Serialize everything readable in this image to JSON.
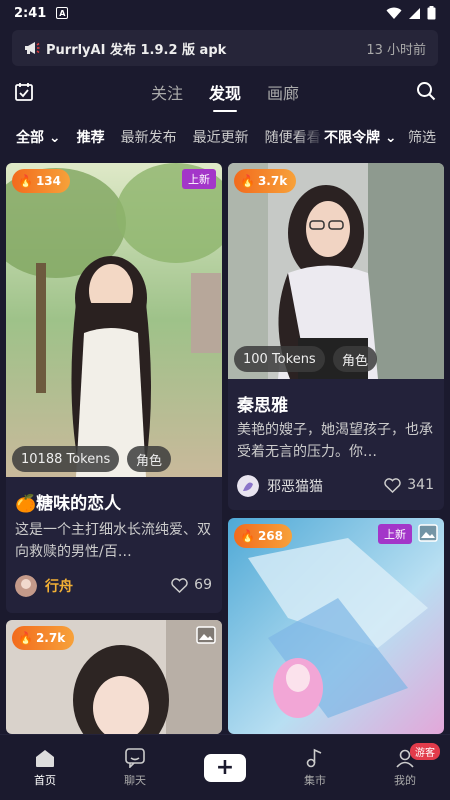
{
  "status": {
    "time": "2:41",
    "notif_icon": "A"
  },
  "notice": {
    "icon": "megaphone-icon",
    "title": "PurrlyAI 发布 1.9.2 版 apk",
    "time": "13 小时前"
  },
  "tabs": [
    {
      "label": "关注",
      "active": false
    },
    {
      "label": "发现",
      "active": true
    },
    {
      "label": "画廊",
      "active": false
    }
  ],
  "filters": {
    "all": "全部",
    "items": [
      "推荐",
      "最新发布",
      "最近更新",
      "随便看看"
    ],
    "token": "不限令牌",
    "screen": "筛选"
  },
  "cards": [
    {
      "hot": "134",
      "new_label": "上新",
      "tokens": "10188 Tokens",
      "tag": "角色",
      "name": "🍊糖味的恋人",
      "desc": "这是一个主打细水长流纯爱、双向救赎的男性/百…",
      "author": "行舟",
      "likes": "69"
    },
    {
      "hot": "3.7k",
      "tokens": "100 Tokens",
      "tag": "角色",
      "name": "秦思雅",
      "desc": "美艳的嫂子，她渴望孩子，也承受着无言的压力。你…",
      "author": "邪恶猫猫",
      "likes": "341"
    },
    {
      "hot": "2.7k"
    },
    {
      "hot": "268",
      "new_label": "上新"
    }
  ],
  "bottom_nav": [
    {
      "label": "首页",
      "active": true
    },
    {
      "label": "聊天"
    },
    {
      "label": "+"
    },
    {
      "label": "集市"
    },
    {
      "label": "我的",
      "badge": "游客"
    }
  ]
}
